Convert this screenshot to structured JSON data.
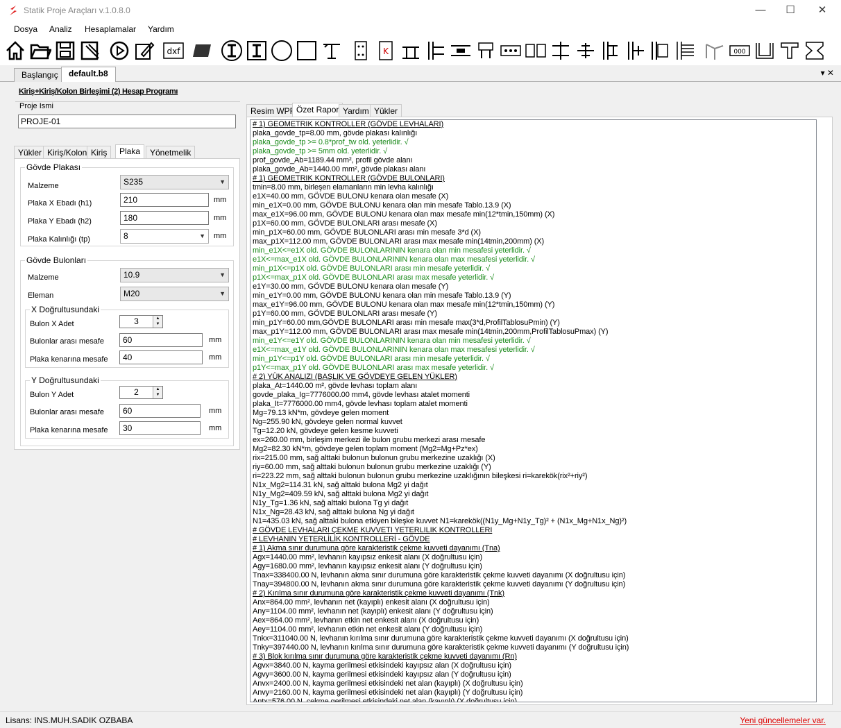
{
  "window": {
    "title": "Statik Proje Araçları v.1.0.8.0",
    "minimize": "—",
    "maximize": "☐",
    "close": "✕"
  },
  "menu": [
    "Dosya",
    "Analiz",
    "Hesaplamalar",
    "Yardım"
  ],
  "doc_tabs": [
    "Başlangıç",
    "default.b8"
  ],
  "doc_controls": "▾ ✕",
  "page_title": "Kiriş+Kiriş/Kolon Birleşimi (2) Hesap Programı",
  "proje": {
    "label": "Proje Ismi",
    "value": "PROJE-01"
  },
  "left_tabs": [
    "Yükler",
    "Kiriş/Kolon",
    "Kiriş",
    "Plaka",
    "Yönetmelik"
  ],
  "govde_plakasi": {
    "title": "Gövde Plakası",
    "malzeme_label": "Malzeme",
    "malzeme_value": "S235",
    "h1_label": "Plaka X Ebadı (h1)",
    "h1_value": "210",
    "h1_unit": "mm",
    "h2_label": "Plaka Y Ebadı (h2)",
    "h2_value": "180",
    "h2_unit": "mm",
    "tp_label": "Plaka Kalınlığı (tp)",
    "tp_value": "8",
    "tp_unit": "mm"
  },
  "govde_bulonlari": {
    "title": "Gövde Bulonları",
    "malzeme_label": "Malzeme",
    "malzeme_value": "10.9",
    "eleman_label": "Eleman",
    "eleman_value": "M20",
    "x": {
      "title": "X Doğrultusundaki",
      "adet_label": "Bulon X Adet",
      "adet_value": "3",
      "mesafe_label": "Bulonlar arası mesafe",
      "mesafe_value": "60",
      "mesafe_unit": "mm",
      "kenar_label": "Plaka kenarına mesafe",
      "kenar_value": "40",
      "kenar_unit": "mm"
    },
    "y": {
      "title": "Y Doğrultusundaki",
      "adet_label": "Bulon Y Adet",
      "adet_value": "2",
      "mesafe_label": "Bulonlar arası mesafe",
      "mesafe_value": "60",
      "mesafe_unit": "mm",
      "kenar_label": "Plaka kenarına mesafe",
      "kenar_value": "30",
      "kenar_unit": "mm"
    }
  },
  "right_tabs": [
    "Resim WPF",
    "Özet Rapor",
    "Yardım",
    "Yükler"
  ],
  "report": [
    {
      "t": "# 1) GEOMETRIK KONTROLLER (GÖVDE LEVHALARI)",
      "s": "h"
    },
    {
      "t": "plaka_govde_tp=8.00 mm, gövde plakası kalınlığı",
      "s": ""
    },
    {
      "t": "plaka_govde_tp >= 0.8*prof_tw old. yeterlidir. √",
      "s": "g"
    },
    {
      "t": "plaka_govde_tp >= 5mm old. yeterlidir. √",
      "s": "g"
    },
    {
      "t": "prof_govde_Ab=1189.44 mm², profil gövde alanı",
      "s": ""
    },
    {
      "t": "plaka_govde_Ab=1440.00 mm², gövde plakası alanı",
      "s": ""
    },
    {
      "t": "# 1) GEOMETRIK KONTROLLER (GÖVDE BULONLARI)",
      "s": "h"
    },
    {
      "t": "tmin=8.00 mm, birleşen elamanların min levha kalınlığı",
      "s": ""
    },
    {
      "t": "e1X=40.00 mm, GÖVDE BULONU kenara olan mesafe (X)",
      "s": ""
    },
    {
      "t": "min_e1X=0.00 mm, GÖVDE BULONU kenara olan min mesafe Tablo.13.9 (X)",
      "s": ""
    },
    {
      "t": "max_e1X=96.00 mm, GÖVDE BULONU kenara olan max mesafe min(12*tmin,150mm) (X)",
      "s": ""
    },
    {
      "t": "p1X=60.00 mm, GÖVDE BULONLARI arası mesafe (X)",
      "s": ""
    },
    {
      "t": "min_p1X=60.00 mm, GÖVDE BULONLARI arası min mesafe 3*d (X)",
      "s": ""
    },
    {
      "t": "max_p1X=112.00 mm, GÖVDE BULONLARI arası max mesafe min(14tmin,200mm) (X)",
      "s": ""
    },
    {
      "t": "min_e1X<=e1X old. GÖVDE BULONLARININ kenara olan min mesafesi yeterlidir. √",
      "s": "g"
    },
    {
      "t": "e1X<=max_e1X old. GÖVDE BULONLARININ kenara olan max mesafesi yeterlidir. √",
      "s": "g"
    },
    {
      "t": "min_p1X<=p1X old. GÖVDE BULONLARI arası min mesafe yeterlidir. √",
      "s": "g"
    },
    {
      "t": "p1X<=max_p1X old. GÖVDE BULONLARI arası max mesafe yeterlidir. √",
      "s": "g"
    },
    {
      "t": "e1Y=30.00 mm, GÖVDE BULONU kenara olan mesafe (Y)",
      "s": ""
    },
    {
      "t": "min_e1Y=0.00 mm, GÖVDE BULONU kenara olan min mesafe Tablo.13.9 (Y)",
      "s": ""
    },
    {
      "t": "max_e1Y=96.00 mm, GÖVDE BULONU kenara olan max mesafe min(12*tmin,150mm) (Y)",
      "s": ""
    },
    {
      "t": "p1Y=60.00 mm, GÖVDE BULONLARI arası mesafe (Y)",
      "s": ""
    },
    {
      "t": "min_p1Y=60.00 mm,GÖVDE BULONLARI arası min mesafe max(3*d,ProfilTablosuPmin) (Y)",
      "s": ""
    },
    {
      "t": "max_p1Y=112.00 mm, GÖVDE BULONLARI arası max mesafe min(14tmin,200mm,ProfilTablosuPmax) (Y)",
      "s": ""
    },
    {
      "t": "min_e1Y<=e1Y old. GÖVDE BULONLARININ kenara olan min mesafesi yeterlidir. √",
      "s": "g"
    },
    {
      "t": "e1X<=max_e1Y old. GÖVDE BULONLARININ kenara olan max mesafesi yeterlidir. √",
      "s": "g"
    },
    {
      "t": "min_p1Y<=p1Y old. GÖVDE BULONLARI arası min mesafe yeterlidir. √",
      "s": "g"
    },
    {
      "t": "p1Y<=max_p1Y old. GÖVDE BULONLARI arası max mesafe yeterlidir. √",
      "s": "g"
    },
    {
      "t": "# 2) YÜK ANALIZI (BAŞLIK VE GÖVDEYE GELEN YÜKLER)",
      "s": "h"
    },
    {
      "t": "plaka_At=1440.00 m², gövde levhası toplam alanı",
      "s": ""
    },
    {
      "t": "govde_plaka_Ig=7776000.00 mm4, gövde levhası atalet momenti",
      "s": ""
    },
    {
      "t": "plaka_It=7776000.00 mm4, gövde levhası toplam atalet momenti",
      "s": ""
    },
    {
      "t": "Mg=79.13 kN*m, gövdeye gelen moment",
      "s": ""
    },
    {
      "t": "Ng=255.90 kN, gövdeye gelen normal kuvvet",
      "s": ""
    },
    {
      "t": "Tg=12.20 kN, gövdeye gelen kesme kuvveti",
      "s": ""
    },
    {
      "t": "ex=260.00 mm, birleşim merkezi ile bulon grubu merkezi arası mesafe",
      "s": ""
    },
    {
      "t": "Mg2=82.30 kN*m, gövdeye gelen toplam moment (Mg2=Mg+Pz*ex)",
      "s": ""
    },
    {
      "t": "rix=215.00 mm, sağ alttaki bulonun bulonun grubu merkezine uzaklığı (X)",
      "s": ""
    },
    {
      "t": "riy=60.00 mm, sağ alttaki bulonun bulonun grubu merkezine uzaklığı (Y)",
      "s": ""
    },
    {
      "t": "ri=223.22 mm, sağ alttaki bulonun bulonun grubu merkezine uzaklığının bileşkesi ri=karekök(rix²+riy²)",
      "s": ""
    },
    {
      "t": "N1x_Mg2=114.31 kN, sağ alttaki bulona Mg2 yi dağıt",
      "s": ""
    },
    {
      "t": "N1y_Mg2=409.59 kN, sağ alttaki bulona Mg2 yi dağıt",
      "s": ""
    },
    {
      "t": "N1y_Tg=1.36 kN, sağ alttaki bulona Tg yi dağıt",
      "s": ""
    },
    {
      "t": "N1x_Ng=28.43 kN, sağ alttaki bulona Ng yi dağıt",
      "s": ""
    },
    {
      "t": "N1=435.03 kN, sağ alttaki bulona etkiyen bileşke kuvvet N1=karekök((N1y_Mg+N1y_Tg)² + (N1x_Mg+N1x_Ng)²)",
      "s": ""
    },
    {
      "t": "# GÖVDE LEVHALARI ÇEKME KUVVETI YETERLILIK KONTROLLERI",
      "s": "h"
    },
    {
      "t": "# LEVHANIN YETERLİLİK KONTROLLERİ - GÖVDE",
      "s": "h"
    },
    {
      "t": "# 1) Akma sınır durumuna göre karakteristik çekme kuvveti dayanımı (Tna)",
      "s": "h"
    },
    {
      "t": "Agx=1440.00 mm², levhanın kayıpsız enkesit alanı (X doğrultusu için)",
      "s": ""
    },
    {
      "t": "Agy=1680.00 mm², levhanın kayıpsız enkesit alanı (Y doğrultusu için)",
      "s": ""
    },
    {
      "t": "Tnax=338400.00 N, levhanın akma sınır durumuna göre karakteristik çekme kuvveti dayanımı (X doğrultusu için)",
      "s": ""
    },
    {
      "t": "Tnay=394800.00 N, levhanın akma sınır durumuna göre karakteristik çekme kuvveti dayanımı (Y doğrultusu için)",
      "s": ""
    },
    {
      "t": "# 2) Kırılma sınır durumuna göre karakteristik çekme kuvveti dayanımı (Tnk)",
      "s": "h"
    },
    {
      "t": "Anx=864.00 mm², levhanın net (kayıplı) enkesit alanı (X doğrultusu için)",
      "s": ""
    },
    {
      "t": "Any=1104.00 mm², levhanın net (kayıplı) enkesit alanı (Y doğrultusu için)",
      "s": ""
    },
    {
      "t": "Aex=864.00 mm², levhanın etkin net enkesit alanı (X doğrultusu için)",
      "s": ""
    },
    {
      "t": "Aey=1104.00 mm², levhanın etkin net enkesit alanı (Y doğrultusu için)",
      "s": ""
    },
    {
      "t": "Tnkx=311040.00 N, levhanın kırılma sınır durumuna göre karakteristik çekme kuvveti dayanımı (X doğrultusu için)",
      "s": ""
    },
    {
      "t": "Tnky=397440.00 N, levhanın kırılma sınır durumuna göre karakteristik çekme kuvveti dayanımı (Y doğrultusu için)",
      "s": ""
    },
    {
      "t": "# 3) Blok kırılma sınır durumuna göre karakteristik çekme kuvveti dayanımı (Rn)",
      "s": "h"
    },
    {
      "t": "Agvx=3840.00 N, kayma gerilmesi etkisindeki kayıpsız alan (X doğrultusu için)",
      "s": ""
    },
    {
      "t": "Agvy=3600.00 N, kayma gerilmesi etkisindeki kayıpsız alan (Y doğrultusu için)",
      "s": ""
    },
    {
      "t": "Anvx=2400.00 N, kayma gerilmesi etkisindeki net alan (kayıplı) (X doğrultusu için)",
      "s": ""
    },
    {
      "t": "Anvy=2160.00 N, kayma gerilmesi etkisindeki net alan (kayıplı) (Y doğrultusu için)",
      "s": ""
    },
    {
      "t": "Antx=576.00 N, çekme gerilmesi etkisindeki net alan (kayıplı) (X doğrultusu için)",
      "s": ""
    }
  ],
  "status": {
    "license": "Lisans: INS.MUH.SADIK OZBABA",
    "update": "Yeni güncellemeler var."
  },
  "colors": {
    "ok_green": "#1a8a1a",
    "update_red": "#dd0000",
    "logo_red": "#e02020"
  }
}
